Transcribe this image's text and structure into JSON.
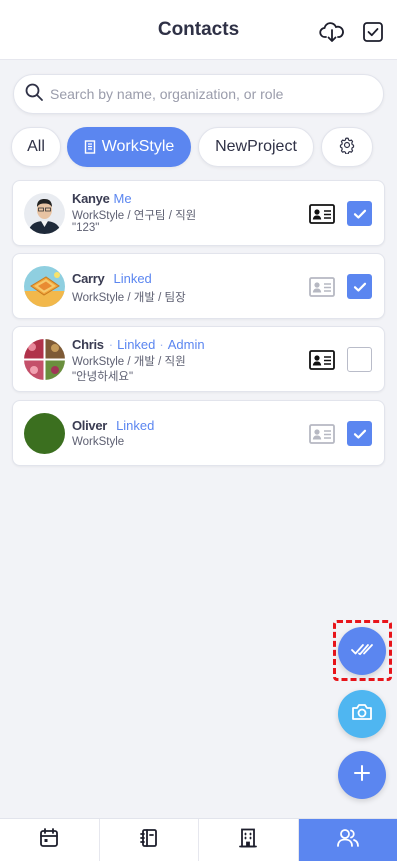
{
  "header": {
    "title": "Contacts",
    "icons": [
      "cloud-download-icon",
      "checkbox-icon"
    ]
  },
  "search": {
    "placeholder": "Search by name, organization, or role",
    "value": ""
  },
  "filters": {
    "chips": [
      {
        "label": "All",
        "active": false
      },
      {
        "label": "WorkStyle",
        "active": true,
        "icon": "building-icon"
      },
      {
        "label": "NewProject",
        "active": false
      }
    ],
    "settings_icon": "gear-icon"
  },
  "contacts": [
    {
      "name": "Kanye",
      "tags": [
        "Me"
      ],
      "org": "WorkStyle / 연구팀 / 직원",
      "status": "\"123\"",
      "card_icon_active": true,
      "checked": true
    },
    {
      "name": "Carry",
      "tags": [
        "Linked"
      ],
      "org": "WorkStyle / 개발 / 팀장",
      "status": "",
      "card_icon_active": false,
      "checked": true
    },
    {
      "name": "Chris",
      "tags": [
        "Linked",
        "Admin"
      ],
      "org": "WorkStyle / 개발 / 직원",
      "status": "\"안녕하세요\"",
      "card_icon_active": true,
      "checked": false
    },
    {
      "name": "Oliver",
      "tags": [
        "Linked"
      ],
      "org": "WorkStyle",
      "status": "",
      "card_icon_active": false,
      "checked": true
    }
  ],
  "tag_separator": "·",
  "fabs": [
    "select-all-icon",
    "camera-icon",
    "plus-icon"
  ],
  "bottom_nav": [
    {
      "icon": "calendar-icon",
      "active": false
    },
    {
      "icon": "notebook-icon",
      "active": false
    },
    {
      "icon": "building-icon",
      "active": false
    },
    {
      "icon": "people-icon",
      "active": true
    }
  ],
  "colors": {
    "accent": "#5b86f0",
    "camera": "#4fb6f1",
    "highlight": "#e8141a"
  }
}
